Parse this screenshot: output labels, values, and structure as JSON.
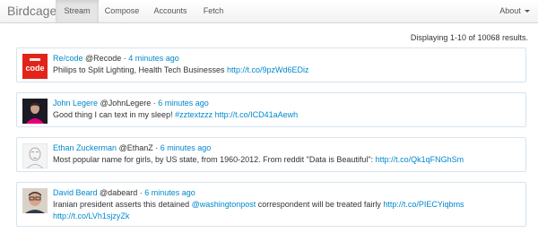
{
  "app": {
    "brand": "Birdcage"
  },
  "nav": {
    "items": [
      {
        "label": "Stream",
        "active": true
      },
      {
        "label": "Compose",
        "active": false
      },
      {
        "label": "Accounts",
        "active": false
      },
      {
        "label": "Fetch",
        "active": false
      }
    ],
    "about_label": "About"
  },
  "summary": "Displaying 1-10 of 10068 results.",
  "sep": "·",
  "tweets": [
    {
      "name": "Re/code",
      "handle": "@Recode",
      "time": "4 minutes ago",
      "text": "Philips to Split Lighting, Health Tech Businesses ",
      "link": "http://t.co/9pzWd6EDiz",
      "avatar_icon": "recode-logo-icon"
    },
    {
      "name": "John Legere",
      "handle": "@JohnLegere",
      "time": "6 minutes ago",
      "text": "Good thing I can text in my sleep! ",
      "hashtag": "#zztextzzz",
      "link": "http://t.co/ICD41aAewh",
      "avatar_icon": "person-photo-icon"
    },
    {
      "name": "Ethan Zuckerman",
      "handle": "@EthanZ",
      "time": "6 minutes ago",
      "text": "Most popular name for girls, by US state, from 1960-2012. From reddit \"Data is Beautiful\": ",
      "link": "http://t.co/Qk1qFNGhSm",
      "avatar_icon": "sketch-portrait-icon"
    },
    {
      "name": "David Beard",
      "handle": "@dabeard",
      "time": "6 minutes ago",
      "text_before": "Iranian president asserts this detained ",
      "mention": "@washingtonpost",
      "text_after": " correspondent will be treated fairly ",
      "link": "http://t.co/PIECYiqbms",
      "link2": "http://t.co/LVh1sjzyZk",
      "avatar_icon": "person-photo-icon"
    }
  ],
  "colors": {
    "link": "#0088cc",
    "card_border": "#d6e4ee",
    "recode_red": "#e2231a"
  }
}
